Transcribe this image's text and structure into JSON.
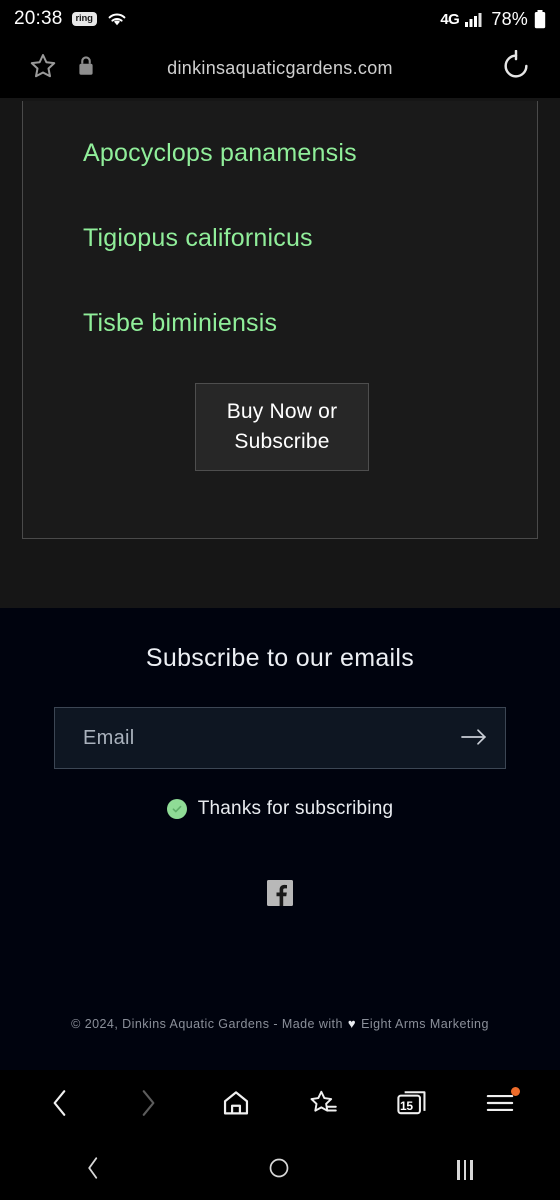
{
  "status_bar": {
    "clock": "20:38",
    "app_badge": "ring",
    "wifi_icon": "wifi-icon",
    "network_label": "4G",
    "signal_icon": "signal-bars-icon",
    "battery_percent": "78%",
    "battery_icon": "battery-icon"
  },
  "address_bar": {
    "url": "dinkinsaquaticgardens.com",
    "star_icon": "star-icon",
    "lock_icon": "lock-icon",
    "reload_icon": "reload-icon"
  },
  "page": {
    "species": [
      {
        "name": "Apocyclops panamensis"
      },
      {
        "name": "Tigiopus californicus"
      },
      {
        "name": "Tisbe biminiensis"
      }
    ],
    "buy_button": "Buy Now or Subscribe",
    "scroll_top_icon": "arrow-up-icon",
    "species_color": "#90ee9a",
    "background_color": "#161616"
  },
  "footer": {
    "heading": "Subscribe to our emails",
    "email_placeholder": "Email",
    "email_value": "",
    "submit_icon": "arrow-right-icon",
    "success_message": "Thanks for subscribing",
    "success_icon": "check-circle-icon",
    "success_color": "#8fdc96",
    "social": [
      {
        "name": "facebook-icon",
        "label": "Facebook"
      }
    ],
    "copyright_prefix": "© 2024, Dinkins Aquatic Gardens - Made with",
    "copyright_heart": "♥",
    "copyright_suffix": "Eight Arms Marketing",
    "background_color": "#00030e"
  },
  "browser_toolbar": {
    "back_label": "Back",
    "forward_label": "Forward",
    "home_label": "Home",
    "bookmarks_label": "Bookmarks",
    "tabs_count": "15",
    "menu_label": "Menu",
    "menu_badge_color": "#ef6c2a"
  },
  "nav_bar": {
    "back_label": "Back",
    "home_label": "Home",
    "recents_label": "Recent apps"
  }
}
